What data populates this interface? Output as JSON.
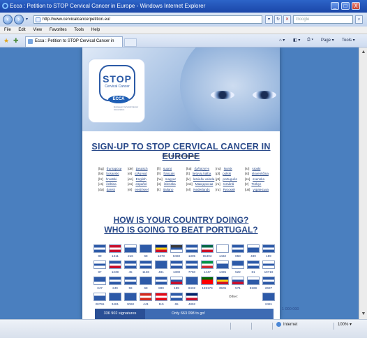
{
  "window": {
    "title": "Ecca : Petition to STOP Cervical Cancer in Europe - Windows Internet Explorer",
    "controls": [
      "_",
      "□",
      "X"
    ]
  },
  "address_bar": {
    "url": "http://www.cervicalcancerpetition.eu/",
    "search_placeholder": "Google"
  },
  "menu": [
    "File",
    "Edit",
    "View",
    "Favorites",
    "Tools",
    "Help"
  ],
  "tab": {
    "title": "Ecca : Petition to STOP Cervical Cancer in Europe"
  },
  "toolbar": {
    "page_label": "Page",
    "tools_label": "Tools"
  },
  "logo": {
    "stop": "STOP",
    "subtitle": "Cervical Cancer",
    "org": "ECCA",
    "org_full": "European Cervical Cancer Association"
  },
  "page": {
    "headline": "SIGN-UP TO STOP CERVICAL CANCER IN EUROPE",
    "language_prompt": "Click on your language :",
    "question_line1": "HOW IS YOUR COUNTRY DOING?",
    "question_line2": "WHO IS GOING TO BEAT PORTUGAL?",
    "other_label": "Other:",
    "signatures": "336 902 signatures",
    "to_go": "Only 663 098 to go!",
    "goal": "1 000 000"
  },
  "languages": [
    [
      {
        "code": "[bg]",
        "name": "български"
      },
      {
        "code": "[bs]",
        "name": "bosanski"
      },
      {
        "code": "[hr]",
        "name": "hrvatski"
      },
      {
        "code": "[cs]",
        "name": "čeština"
      },
      {
        "code": "[da]",
        "name": "dansk"
      }
    ],
    [
      {
        "code": "[de]",
        "name": "Deutsch"
      },
      {
        "code": "[el]",
        "name": "ελληνικά"
      },
      {
        "code": "[en]",
        "name": "English"
      },
      {
        "code": "[es]",
        "name": "español"
      },
      {
        "code": "[et]",
        "name": "eesti keel"
      }
    ],
    [
      {
        "code": "[fi]",
        "name": "suomi"
      },
      {
        "code": "[fr]",
        "name": "français"
      },
      {
        "code": "[hu]",
        "name": "magyar"
      },
      {
        "code": "[is]",
        "name": "íslenska"
      },
      {
        "code": "[it]",
        "name": "italiano"
      }
    ],
    [
      {
        "code": "[ka]",
        "name": "ქართული"
      },
      {
        "code": "[lt]",
        "name": "lietuvių kalba"
      },
      {
        "code": "[lv]",
        "name": "latviešu valoda"
      },
      {
        "code": "[mk]",
        "name": "Македонски"
      },
      {
        "code": "[nl]",
        "name": "Nederlands"
      }
    ],
    [
      {
        "code": "[no]",
        "name": "Norsk"
      },
      {
        "code": "[pl]",
        "name": "polski"
      },
      {
        "code": "[pt]",
        "name": "português"
      },
      {
        "code": "[ro]",
        "name": "română"
      },
      {
        "code": "[ru]",
        "name": "Русский"
      }
    ],
    [
      {
        "code": "[sr]",
        "name": "srpski"
      },
      {
        "code": "[sl]",
        "name": "slovenščina"
      },
      {
        "code": "[sv]",
        "name": "svenska"
      },
      {
        "code": "[tr]",
        "name": "Türkçe"
      },
      {
        "code": "[uk]",
        "name": "українська"
      }
    ]
  ],
  "flag_rows": [
    [
      {
        "count": "89",
        "colors": [
          "#2d5aa8",
          "#ffffff",
          "#2d5aa8"
        ]
      },
      {
        "count": "1311",
        "colors": [
          "#c8102e",
          "#ffffff",
          "#c8102e"
        ]
      },
      {
        "count": "216",
        "colors": [
          "#ffffff",
          "#2d5aa8",
          "#2d5aa8"
        ]
      },
      {
        "count": "68",
        "colors": [
          "#2d5aa8",
          "#2d5aa8",
          "#2d5aa8"
        ]
      },
      {
        "count": "1370",
        "colors": [
          "#002b7f",
          "#fcd116",
          "#ce1126"
        ]
      },
      {
        "count": "8460",
        "colors": [
          "#3a3a3a",
          "#2d5aa8",
          "#ffffff"
        ]
      },
      {
        "count": "1305",
        "colors": [
          "#2d5aa8",
          "#ffffff",
          "#2d5aa8"
        ]
      },
      {
        "count": "65493",
        "colors": [
          "#006847",
          "#ffffff",
          "#ce1126"
        ]
      },
      {
        "count": "1432",
        "colors": [
          "#ffffff",
          "#ffffff",
          "#ffffff"
        ]
      },
      {
        "count": "858",
        "colors": [
          "#2d5aa8",
          "#ffffff",
          "#2d5aa8"
        ]
      },
      {
        "count": "489",
        "colors": [
          "#ffffff",
          "#2d5aa8",
          "#2d5aa8"
        ]
      },
      {
        "count": "159",
        "colors": [
          "#2d5aa8",
          "#ffffff",
          "#2d5aa8"
        ]
      }
    ],
    [
      {
        "count": "87",
        "colors": [
          "#ffffff",
          "#2d5aa8",
          "#ffffff"
        ]
      },
      {
        "count": "1239",
        "colors": [
          "#2d5aa8",
          "#ffffff",
          "#c8102e"
        ]
      },
      {
        "count": "45",
        "colors": [
          "#2d5aa8",
          "#ffffff",
          "#2d5aa8"
        ]
      },
      {
        "count": "1136",
        "colors": [
          "#2d5aa8",
          "#ffffff",
          "#2d5aa8"
        ]
      },
      {
        "count": "481",
        "colors": [
          "#2d5aa8",
          "#2d5aa8",
          "#2d5aa8"
        ]
      },
      {
        "count": "1300",
        "colors": [
          "#2d5aa8",
          "#ffffff",
          "#2d5aa8"
        ]
      },
      {
        "count": "7750",
        "colors": [
          "#2d5aa8",
          "#ffffff",
          "#2d5aa8"
        ]
      },
      {
        "count": "1447",
        "colors": [
          "#009246",
          "#ffffff",
          "#ce2b37"
        ]
      },
      {
        "count": "1495",
        "colors": [
          "#ffffff",
          "#2d5aa8",
          "#2d5aa8"
        ]
      },
      {
        "count": "522",
        "colors": [
          "#2d5aa8",
          "#2d5aa8",
          "#ffffff"
        ]
      },
      {
        "count": "81",
        "colors": [
          "#2d5aa8",
          "#ffffff",
          "#2d5aa8"
        ]
      },
      {
        "count": "19719",
        "colors": [
          "#ffffff",
          "#2d5aa8",
          "#ffffff"
        ]
      }
    ],
    [
      {
        "count": "347",
        "colors": [
          "#2d5aa8",
          "#2d5aa8",
          "#ffffff"
        ]
      },
      {
        "count": "249",
        "colors": [
          "#2d5aa8",
          "#ffffff",
          "#2d5aa8"
        ]
      },
      {
        "count": "59",
        "colors": [
          "#2d5aa8",
          "#ffffff",
          "#2d5aa8"
        ]
      },
      {
        "count": "68",
        "colors": [
          "#2d5aa8",
          "#2d5aa8",
          "#2d5aa8"
        ]
      },
      {
        "count": "880",
        "colors": [
          "#2d5aa8",
          "#ffffff",
          "#2d5aa8"
        ]
      },
      {
        "count": "189",
        "colors": [
          "#ffffff",
          "#2d5aa8",
          "#c8102e"
        ]
      },
      {
        "count": "8432",
        "colors": [
          "#2d5aa8",
          "#2d5aa8",
          "#2d5aa8"
        ]
      },
      {
        "count": "159179",
        "colors": [
          "#006600",
          "#ff0000",
          "#ff0000"
        ]
      },
      {
        "count": "3505",
        "colors": [
          "#002b7f",
          "#fcd116",
          "#ce1126"
        ]
      },
      {
        "count": "571",
        "colors": [
          "#ffffff",
          "#2d5aa8",
          "#c8102e"
        ]
      },
      {
        "count": "8169",
        "colors": [
          "#ffffff",
          "#2d5aa8",
          "#2d5aa8"
        ]
      },
      {
        "count": "2697",
        "colors": [
          "#2d5aa8",
          "#ffffff",
          "#2d5aa8"
        ]
      }
    ],
    [
      {
        "count": "28755",
        "colors": [
          "#ffffff",
          "#2d5aa8",
          "#2d5aa8"
        ]
      },
      {
        "count": "3481",
        "colors": [
          "#2d5aa8",
          "#2d5aa8",
          "#2d5aa8"
        ]
      },
      {
        "count": "3060",
        "colors": [
          "#2d5aa8",
          "#2d5aa8",
          "#2d5aa8"
        ]
      },
      {
        "count": "441",
        "colors": [
          "#d52b1e",
          "#ffffff",
          "#d52b1e"
        ]
      },
      {
        "count": "115",
        "colors": [
          "#e30a17",
          "#ffffff",
          "#e30a17"
        ]
      },
      {
        "count": "65",
        "colors": [
          "#2d5aa8",
          "#ffffff",
          "#2d5aa8"
        ]
      },
      {
        "count": "4892",
        "colors": [
          "#012169",
          "#ffffff",
          "#c8102e"
        ]
      }
    ]
  ],
  "other_count": "2481",
  "status": {
    "zone": "Internet",
    "zoom": "100%"
  }
}
